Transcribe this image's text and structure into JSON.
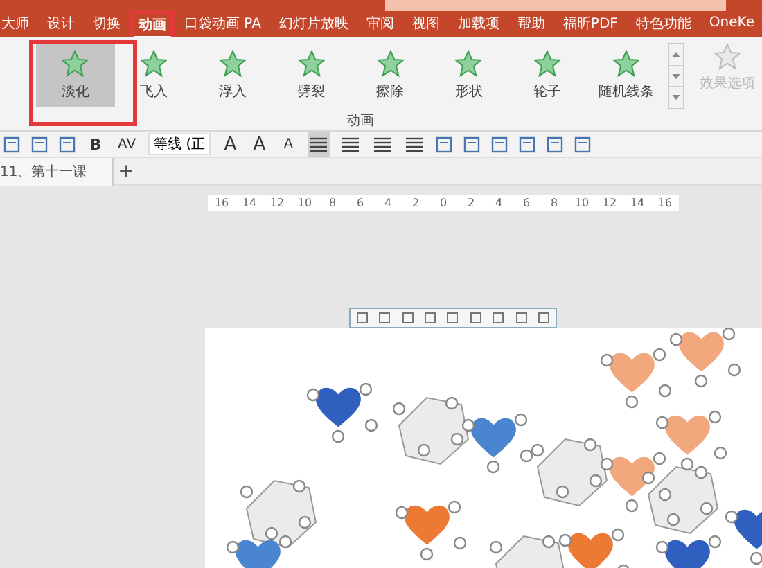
{
  "ribbon_tabs": [
    {
      "label": "大师",
      "selected": false
    },
    {
      "label": "设计",
      "selected": false
    },
    {
      "label": "切换",
      "selected": false
    },
    {
      "label": "动画",
      "selected": true
    },
    {
      "label": "口袋动画 PA",
      "selected": false
    },
    {
      "label": "幻灯片放映",
      "selected": false
    },
    {
      "label": "审阅",
      "selected": false
    },
    {
      "label": "视图",
      "selected": false
    },
    {
      "label": "加载项",
      "selected": false
    },
    {
      "label": "帮助",
      "selected": false
    },
    {
      "label": "福昕PDF",
      "selected": false
    },
    {
      "label": "特色功能",
      "selected": false
    },
    {
      "label": "OneKe",
      "selected": false
    }
  ],
  "animation_gallery": {
    "group_label": "动画",
    "items": [
      {
        "label": "淡化",
        "selected": true
      },
      {
        "label": "飞入",
        "selected": false
      },
      {
        "label": "浮入",
        "selected": false
      },
      {
        "label": "劈裂",
        "selected": false
      },
      {
        "label": "擦除",
        "selected": false
      },
      {
        "label": "形状",
        "selected": false
      },
      {
        "label": "轮子",
        "selected": false
      },
      {
        "label": "随机线条",
        "selected": false
      }
    ],
    "effect_options": {
      "label": "效果选项",
      "disabled": true
    }
  },
  "format_toolbar": {
    "bold": "B",
    "spacing": "AV",
    "font": "等线 (正",
    "font_color": "A",
    "grow": "A",
    "shrink": "A"
  },
  "document_tabs": [
    {
      "label": "11、第十一课",
      "selected": true
    }
  ],
  "new_tab": "+",
  "ruler": [
    "16",
    "14",
    "12",
    "10",
    "8",
    "6",
    "4",
    "2",
    "0",
    "2",
    "4",
    "6",
    "8",
    "10",
    "12",
    "14",
    "16"
  ]
}
